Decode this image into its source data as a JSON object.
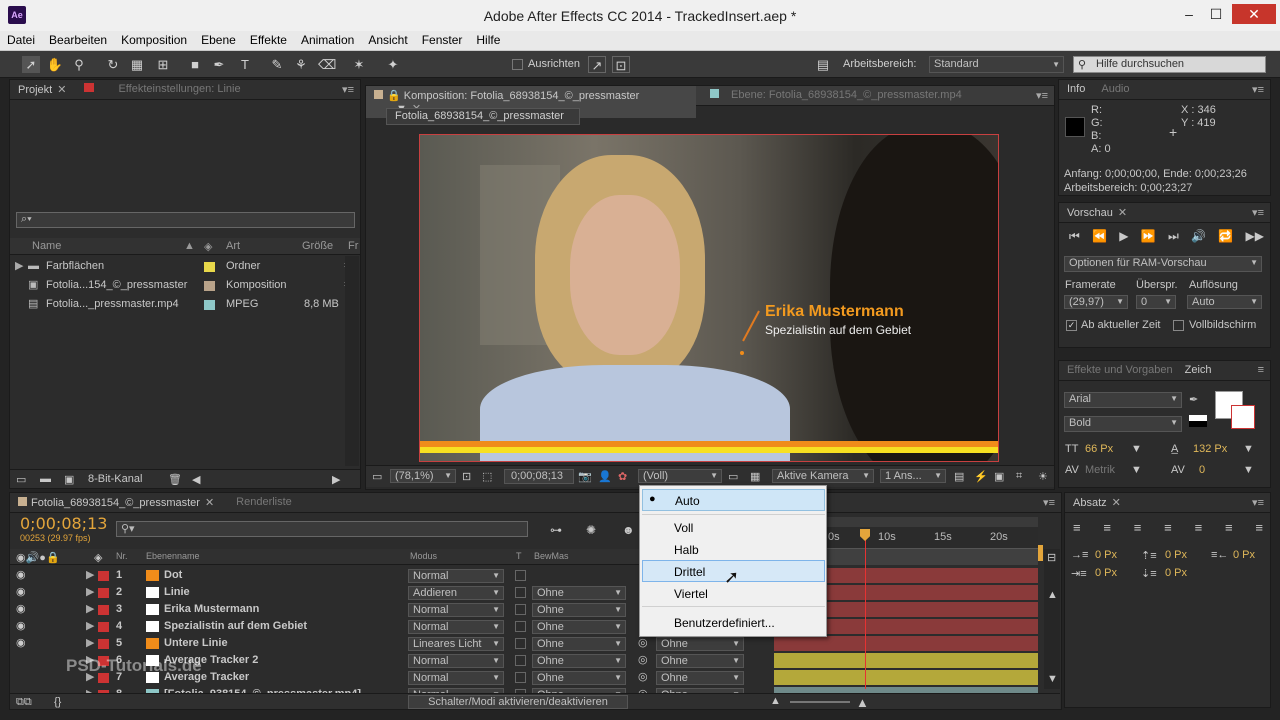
{
  "app": {
    "title": "Adobe After Effects CC 2014 - TrackedInsert.aep *",
    "icon": "Ae"
  },
  "menu": [
    "Datei",
    "Bearbeiten",
    "Komposition",
    "Ebene",
    "Effekte",
    "Animation",
    "Ansicht",
    "Fenster",
    "Hilfe"
  ],
  "toolbar": {
    "align_label": "Ausrichten",
    "workspace_label": "Arbeitsbereich:",
    "workspace_value": "Standard",
    "help_placeholder": "Hilfe durchsuchen"
  },
  "project": {
    "tab": "Projekt",
    "tab2": "Effekteinstellungen: Linie",
    "search_placeholder": "⌕▾",
    "columns": [
      "Name",
      "Art",
      "Größe",
      "Fr"
    ],
    "items": [
      {
        "name": "Farbflächen",
        "type": "Ordner",
        "size": "",
        "color": "#e8d84a"
      },
      {
        "name": "Fotolia...154_©_pressmaster",
        "type": "Komposition",
        "size": "",
        "color": "#b9a38a"
      },
      {
        "name": "Fotolia..._pressmaster.mp4",
        "type": "MPEG",
        "size": "8,8 MB",
        "color": "#8ec7c7"
      }
    ],
    "bitdepth": "8-Bit-Kanal"
  },
  "comp": {
    "tab": "Komposition: Fotolia_68938154_©_pressmaster",
    "tab2": "Ebene: Fotolia_68938154_©_pressmaster.mp4",
    "crumb": "Fotolia_68938154_©_pressmaster",
    "lower_third_name": "Erika Mustermann",
    "lower_third_title": "Spezialistin auf dem Gebiet",
    "zoom": "(78,1%)",
    "timecode": "0;00;08;13",
    "resolution": "(Voll)",
    "camera": "Aktive Kamera",
    "views": "1 Ans..."
  },
  "info": {
    "tab": "Info",
    "tab2": "Audio",
    "r": "R:",
    "g": "G:",
    "b": "B:",
    "a": "A: 0",
    "x": "X : 346",
    "y": "Y : 419",
    "line1": "Anfang: 0;00;00;00, Ende: 0;00;23;26",
    "line2": "Arbeitsbereich: 0;00;23;27"
  },
  "preview": {
    "tab": "Vorschau",
    "ram_options": "Optionen für RAM-Vorschau",
    "framerate_label": "Framerate",
    "skip_label": "Überspr.",
    "res_label": "Auflösung",
    "framerate": "(29,97)",
    "skip": "0",
    "res": "Auto",
    "from_current": "Ab aktueller Zeit",
    "fullscreen": "Vollbildschirm"
  },
  "effects": {
    "tab": "Effekte und Vorgaben",
    "tab2": "Zeich",
    "font": "Arial",
    "style": "Bold",
    "size": "66 Px",
    "leading": "132 Px",
    "kerning": "Metrik",
    "tracking": "0"
  },
  "paragraph": {
    "tab": "Absatz",
    "v1": "0 Px",
    "v2": "0 Px",
    "v3": "0 Px",
    "v4": "0 Px",
    "v5": "0 Px"
  },
  "timeline": {
    "tab": "Fotolia_68938154_©_pressmaster",
    "tab2": "Renderliste",
    "timecode": "0;00;08;13",
    "fps": "00253 (29.97 fps)",
    "cols": {
      "nr": "Nr.",
      "name": "Ebenenname",
      "mode": "Modus",
      "t": "T",
      "track": "BewMas"
    },
    "ruler": [
      "0s",
      "10s",
      "15s",
      "20s"
    ],
    "layers": [
      {
        "nr": "1",
        "name": "Dot",
        "mode": "Normal",
        "track": "",
        "color": "#f08c1a",
        "bar": "#8a3a3a"
      },
      {
        "nr": "2",
        "name": "Linie",
        "mode": "Addieren",
        "track": "Ohne",
        "color": "#ffffff",
        "bar": "#8a3a3a"
      },
      {
        "nr": "3",
        "name": "Erika Mustermann",
        "mode": "Normal",
        "track": "Ohne",
        "color": "#ffffff",
        "bar": "#8a3a3a"
      },
      {
        "nr": "4",
        "name": "Spezialistin auf dem Gebiet",
        "mode": "Normal",
        "track": "Ohne",
        "color": "#ffffff",
        "bar": "#8a3a3a"
      },
      {
        "nr": "5",
        "name": "Untere Linie",
        "mode": "Lineares Licht",
        "track": "Ohne",
        "color": "#f08c1a",
        "bar": "#8a3a3a"
      },
      {
        "nr": "6",
        "name": "Average Tracker 2",
        "mode": "Normal",
        "track": "Ohne",
        "color": "#ffffff",
        "bar": "#b4a83a"
      },
      {
        "nr": "7",
        "name": "Average Tracker",
        "mode": "Normal",
        "track": "Ohne",
        "color": "#ffffff",
        "bar": "#b4a83a"
      },
      {
        "nr": "8",
        "name": "[Fotolia_938154_©_pressmaster.mp4]",
        "mode": "Normal",
        "track": "Ohne",
        "color": "#8ec7c7",
        "bar": "#6f8a8a"
      }
    ],
    "parent_none": "Ohne",
    "toggle": "Schalter/Modi aktivieren/deaktivieren"
  },
  "popup": {
    "items": [
      "Auto",
      "Voll",
      "Halb",
      "Drittel",
      "Viertel",
      "Benutzerdefiniert..."
    ],
    "selected": "Auto",
    "hover": "Drittel"
  },
  "watermark": "PSD-Tutorials.de"
}
